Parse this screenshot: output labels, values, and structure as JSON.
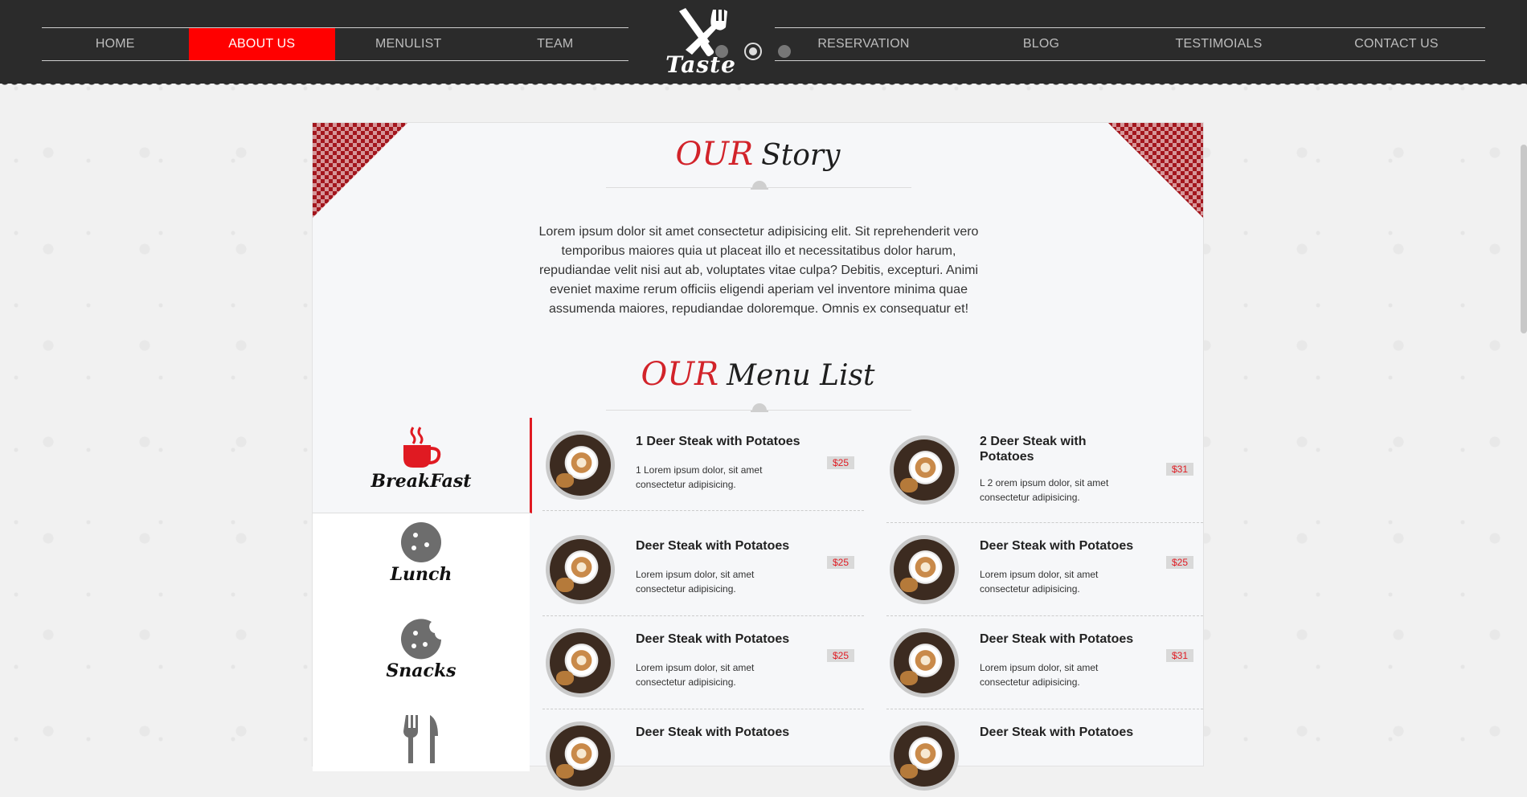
{
  "nav": {
    "left": [
      {
        "label": "HOME",
        "active": false
      },
      {
        "label": "ABOUT US",
        "active": true
      },
      {
        "label": "MENULIST",
        "active": false
      },
      {
        "label": "TEAM",
        "active": false
      }
    ],
    "right": [
      {
        "label": "RESERVATION"
      },
      {
        "label": "BLOG"
      },
      {
        "label": "TESTIMOIALS"
      },
      {
        "label": "CONTACT US"
      }
    ],
    "logo_text": "Taste",
    "accent_color": "#ff0000"
  },
  "story": {
    "title_accent": "OUR",
    "title_rest": "Story",
    "text": "Lorem ipsum dolor sit amet consectetur adipisicing elit. Sit reprehenderit vero temporibus maiores quia ut placeat illo et necessitatibus dolor harum, repudiandae velit nisi aut ab, voluptates vitae culpa? Debitis, excepturi. Animi eveniet maxime rerum officiis eligendi aperiam vel inventore minima quae assumenda maiores, repudiandae doloremque. Omnis ex consequatur et!"
  },
  "menu": {
    "title_accent": "OUR",
    "title_rest": "Menu List",
    "categories": [
      {
        "label": "BreakFast",
        "icon": "coffee-cup-icon",
        "active": true
      },
      {
        "label": "Lunch",
        "icon": "cookie-icon",
        "active": false
      },
      {
        "label": "Snacks",
        "icon": "bitten-cookie-icon",
        "active": false
      },
      {
        "label": "",
        "icon": "fork-knife-icon",
        "active": false
      }
    ],
    "items": [
      {
        "title": "1 Deer Steak with Potatoes",
        "desc": "1 Lorem ipsum dolor, sit amet consectetur adipisicing.",
        "price": "$25"
      },
      {
        "title": "2 Deer Steak with Potatoes",
        "desc": "L 2 orem ipsum dolor, sit amet consectetur adipisicing.",
        "price": "$31"
      },
      {
        "title": "Deer Steak with Potatoes",
        "desc": "Lorem ipsum dolor, sit amet consectetur adipisicing.",
        "price": "$25"
      },
      {
        "title": "Deer Steak with Potatoes",
        "desc": "Lorem ipsum dolor, sit amet consectetur adipisicing.",
        "price": "$25"
      },
      {
        "title": "Deer Steak with Potatoes",
        "desc": "Lorem ipsum dolor, sit amet consectetur adipisicing.",
        "price": "$25"
      },
      {
        "title": "Deer Steak with Potatoes",
        "desc": "Lorem ipsum dolor, sit amet consectetur adipisicing.",
        "price": "$31"
      },
      {
        "title": "Deer Steak with Potatoes",
        "desc": "",
        "price": ""
      },
      {
        "title": "Deer Steak with Potatoes",
        "desc": "",
        "price": ""
      }
    ]
  }
}
